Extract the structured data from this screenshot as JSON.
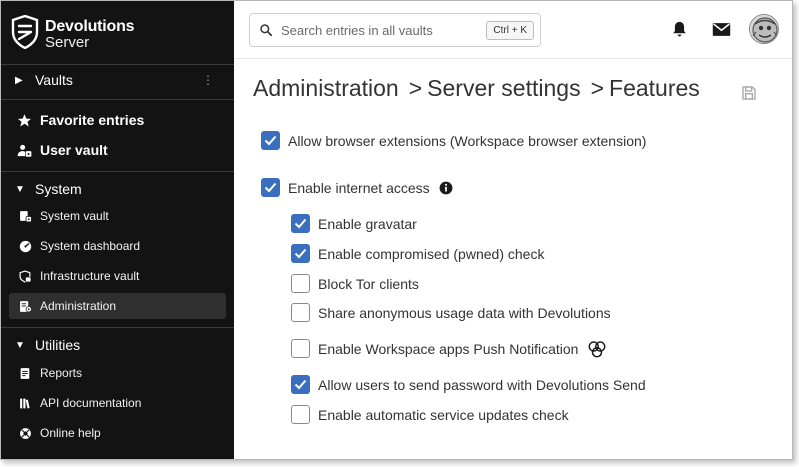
{
  "brand": {
    "name": "Devolutions",
    "product": "Server"
  },
  "sidebar": {
    "vaults_label": "Vaults",
    "favorites_label": "Favorite entries",
    "user_vault_label": "User vault",
    "system": {
      "label": "System",
      "items": [
        {
          "label": "System vault",
          "icon": "system-vault-icon"
        },
        {
          "label": "System dashboard",
          "icon": "dashboard-icon"
        },
        {
          "label": "Infrastructure vault",
          "icon": "infrastructure-vault-icon"
        },
        {
          "label": "Administration",
          "icon": "administration-icon",
          "active": true
        }
      ]
    },
    "utilities": {
      "label": "Utilities",
      "items": [
        {
          "label": "Reports",
          "icon": "reports-icon"
        },
        {
          "label": "API documentation",
          "icon": "api-documentation-icon"
        },
        {
          "label": "Online help",
          "icon": "online-help-icon"
        }
      ]
    }
  },
  "header": {
    "search_placeholder": "Search entries in all vaults",
    "search_shortcut": "Ctrl + K"
  },
  "breadcrumb": {
    "items": [
      "Administration",
      "Server settings",
      "Features"
    ],
    "separator": ">"
  },
  "features": [
    {
      "label": "Allow browser extensions (Workspace browser extension)",
      "checked": true
    },
    {
      "label": "Enable internet access",
      "checked": true
    },
    {
      "label": "Enable gravatar",
      "checked": true
    },
    {
      "label": "Enable compromised (pwned) check",
      "checked": true
    },
    {
      "label": "Block Tor clients",
      "checked": false
    },
    {
      "label": "Share anonymous usage data with Devolutions",
      "checked": false
    },
    {
      "label": "Enable Workspace apps Push Notification",
      "checked": false
    },
    {
      "label": "Allow users to send password with Devolutions Send",
      "checked": true
    },
    {
      "label": "Enable automatic service updates check",
      "checked": false
    }
  ],
  "colors": {
    "sidebar_bg": "#131313",
    "checkbox_checked": "#3a6fbf",
    "active_item_bg": "#2f2f2f"
  }
}
